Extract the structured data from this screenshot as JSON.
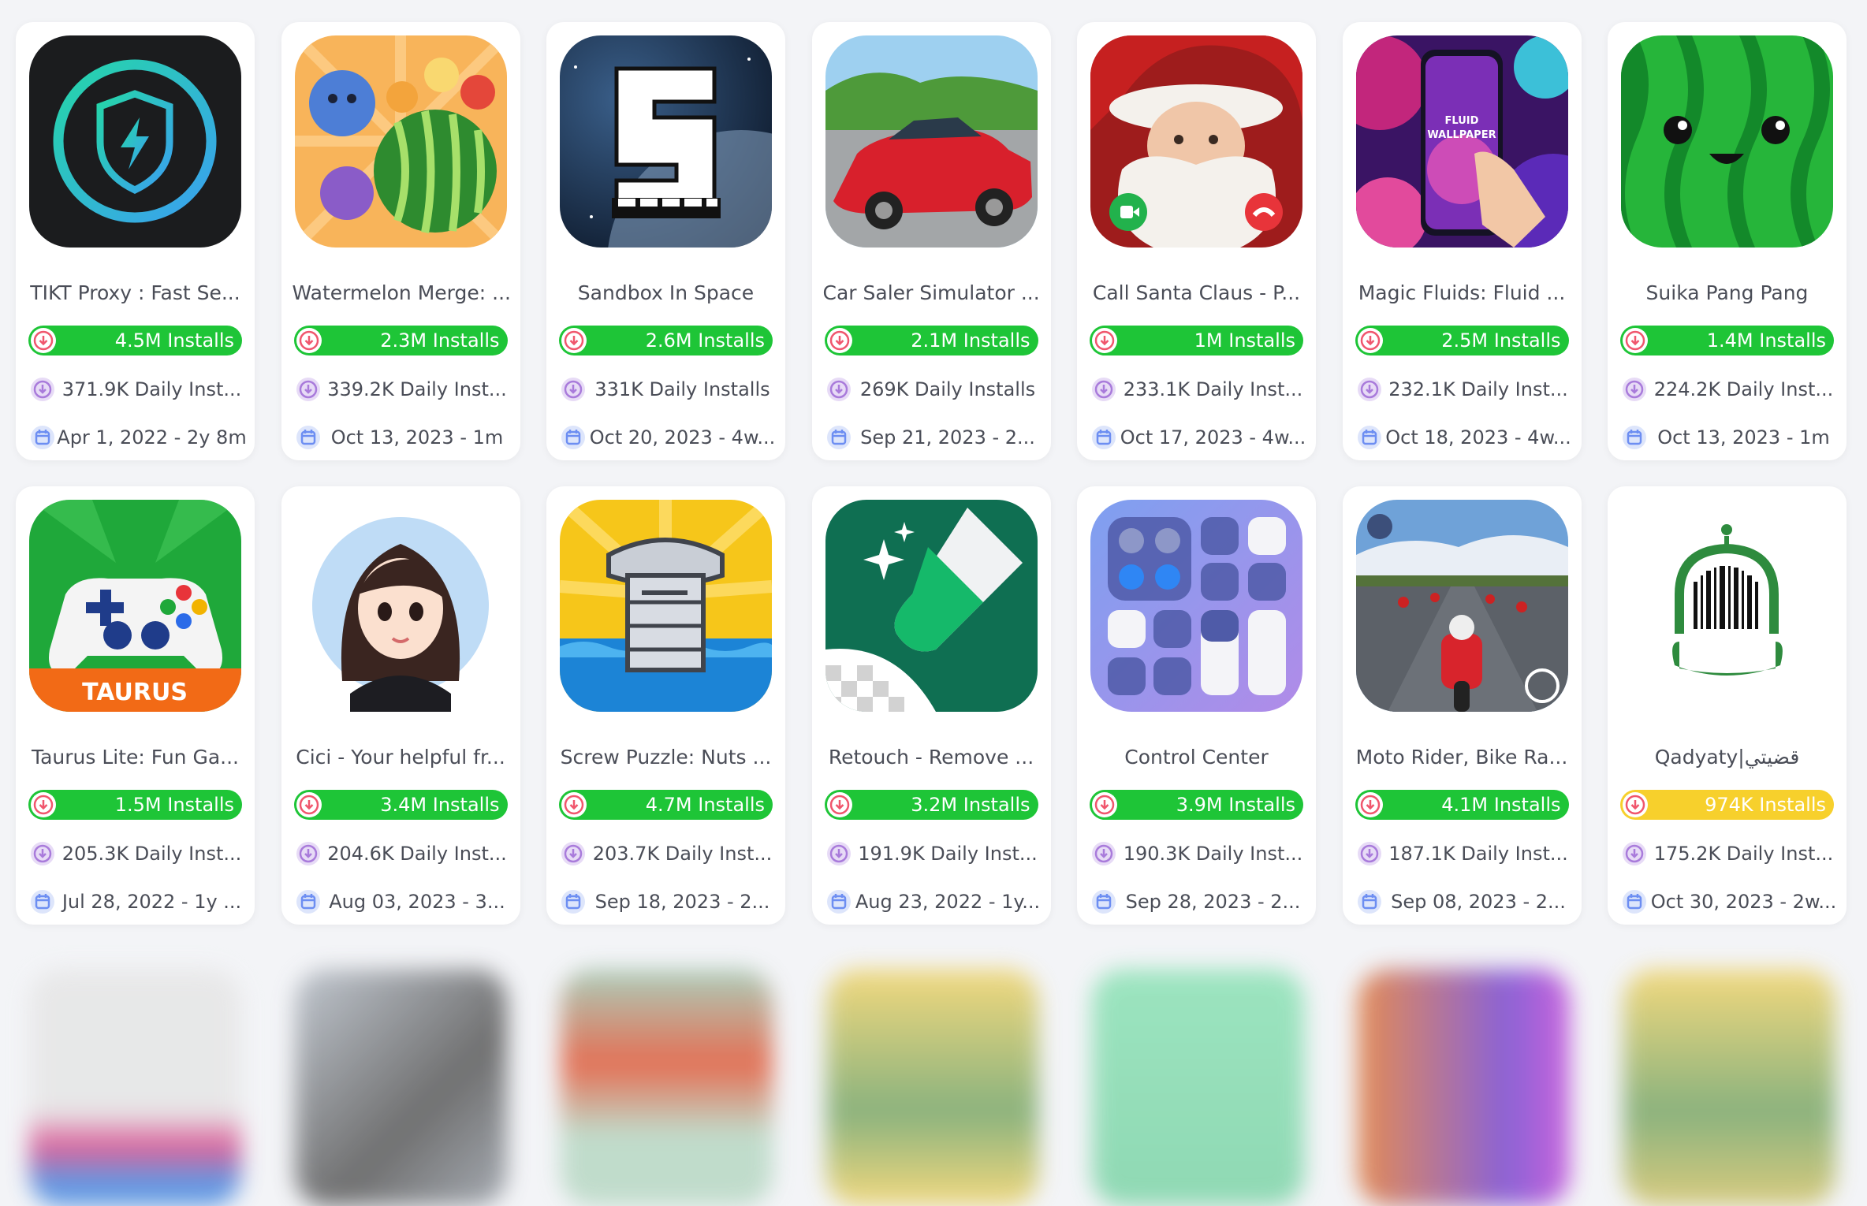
{
  "colors": {
    "install_green": "#1ec537",
    "install_yellow": "#f7d02c",
    "accent_purple": "#a97bdb",
    "accent_blue": "#6d8ef2",
    "accent_red": "#f0566d"
  },
  "apps": [
    {
      "name": "TIKT Proxy : Fast Se...",
      "installs": "4.5M Installs",
      "daily": "371.9K Daily Inst...",
      "date": "Apr 1, 2022 - 2y 8m",
      "badge": "green",
      "icon": "shield-bolt-icon"
    },
    {
      "name": "Watermelon Merge: ...",
      "installs": "2.3M Installs",
      "daily": "339.2K Daily Inst...",
      "date": "Oct 13, 2023 - 1m",
      "badge": "green",
      "icon": "fruit-merge-icon"
    },
    {
      "name": "Sandbox In Space",
      "installs": "2.6M Installs",
      "daily": "331K Daily Installs",
      "date": "Oct 20, 2023 - 4w...",
      "badge": "green",
      "icon": "space-s-icon"
    },
    {
      "name": "Car Saler Simulator ...",
      "installs": "2.1M Installs",
      "daily": "269K Daily Installs",
      "date": "Sep 21, 2023 - 2...",
      "badge": "green",
      "icon": "red-car-icon"
    },
    {
      "name": "Call Santa Claus - P...",
      "installs": "1M Installs",
      "daily": "233.1K Daily Inst...",
      "date": "Oct 17, 2023 - 4w...",
      "badge": "green",
      "icon": "santa-call-icon"
    },
    {
      "name": "Magic Fluids: Fluid ...",
      "installs": "2.5M Installs",
      "daily": "232.1K Daily Inst...",
      "date": "Oct 18, 2023 - 4w...",
      "badge": "green",
      "icon": "fluid-wallpaper-icon",
      "icon_text": [
        "FLUID",
        "WALLPAPER"
      ]
    },
    {
      "name": "Suika Pang Pang",
      "installs": "1.4M Installs",
      "daily": "224.2K Daily Inst...",
      "date": "Oct 13, 2023 - 1m",
      "badge": "green",
      "icon": "watermelon-face-icon"
    },
    {
      "name": "Taurus Lite: Fun Ga...",
      "installs": "1.5M Installs",
      "daily": "205.3K Daily Inst...",
      "date": "Jul 28, 2022 - 1y ...",
      "badge": "green",
      "icon": "gamepad-icon",
      "icon_text": [
        "TAURUS"
      ]
    },
    {
      "name": "Cici - Your helpful fr...",
      "installs": "3.4M Installs",
      "daily": "204.6K Daily Inst...",
      "date": "Aug 03, 2023 - 3...",
      "badge": "green",
      "icon": "avatar-girl-icon"
    },
    {
      "name": "Screw Puzzle: Nuts ...",
      "installs": "4.7M Installs",
      "daily": "203.7K Daily Inst...",
      "date": "Sep 18, 2023 - 2...",
      "badge": "green",
      "icon": "screw-icon"
    },
    {
      "name": "Retouch - Remove ...",
      "installs": "3.2M Installs",
      "daily": "191.9K Daily Inst...",
      "date": "Aug 23, 2022 - 1y...",
      "badge": "green",
      "icon": "eraser-icon"
    },
    {
      "name": "Control Center",
      "installs": "3.9M Installs",
      "daily": "190.3K Daily Inst...",
      "date": "Sep 28, 2023 - 2...",
      "badge": "green",
      "icon": "control-center-icon"
    },
    {
      "name": "Moto Rider, Bike Ra...",
      "installs": "4.1M Installs",
      "daily": "187.1K Daily Inst...",
      "date": "Sep 08, 2023 - 2...",
      "badge": "green",
      "icon": "moto-race-icon"
    },
    {
      "name": "Qadyaty|قضيتي",
      "installs": "974K Installs",
      "daily": "175.2K Daily Inst...",
      "date": "Oct 30, 2023 - 2w...",
      "badge": "yellow",
      "icon": "barcode-dome-icon"
    }
  ]
}
